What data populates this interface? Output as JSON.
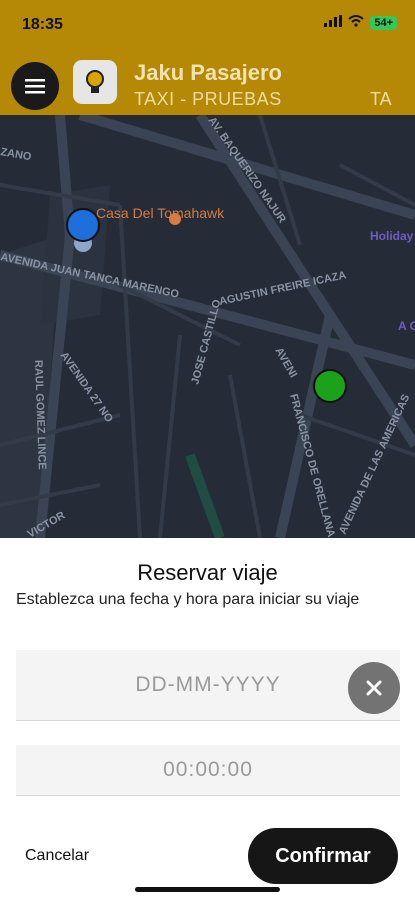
{
  "status_bar": {
    "time": "18:35",
    "battery": "54+"
  },
  "header": {
    "title": "Jaku Pasajero",
    "subtitle": "TAXI - PRUEBAS",
    "subtitle_right": "TA"
  },
  "map": {
    "poi": "Casa Del Tomahawk",
    "labels": {
      "zano": "ZANO",
      "baquerizo": "AV. BAQUERIZO NAJUR",
      "freire": "AGUSTIN FREIRE ICAZA",
      "tanca": "AVENIDA JUAN TANCA MARENGO",
      "dr27": "AVENIDA 27 NO",
      "gomez": "RAUL GOMEZ LINCE",
      "castillo": "JOSE CASTILLO",
      "orellana": "FRANCISCO DE ORELLANA",
      "delas": "AVENIDA DE LAS AMERICAS",
      "victor": "VICTOR",
      "avenida": "AVENI",
      "hotel": "Holiday Guay Airpo IHG I",
      "gu": "A Gu"
    },
    "colors": {
      "origin": "#1e6fd9",
      "destination": "#1aa31a"
    }
  },
  "booking": {
    "title": "Reservar viaje",
    "description": "Establezca una fecha y hora para iniciar su viaje",
    "date_placeholder": "DD-MM-YYYY",
    "time_placeholder": "00:00:00",
    "cancel_label": "Cancelar",
    "confirm_label": "Confirmar"
  }
}
